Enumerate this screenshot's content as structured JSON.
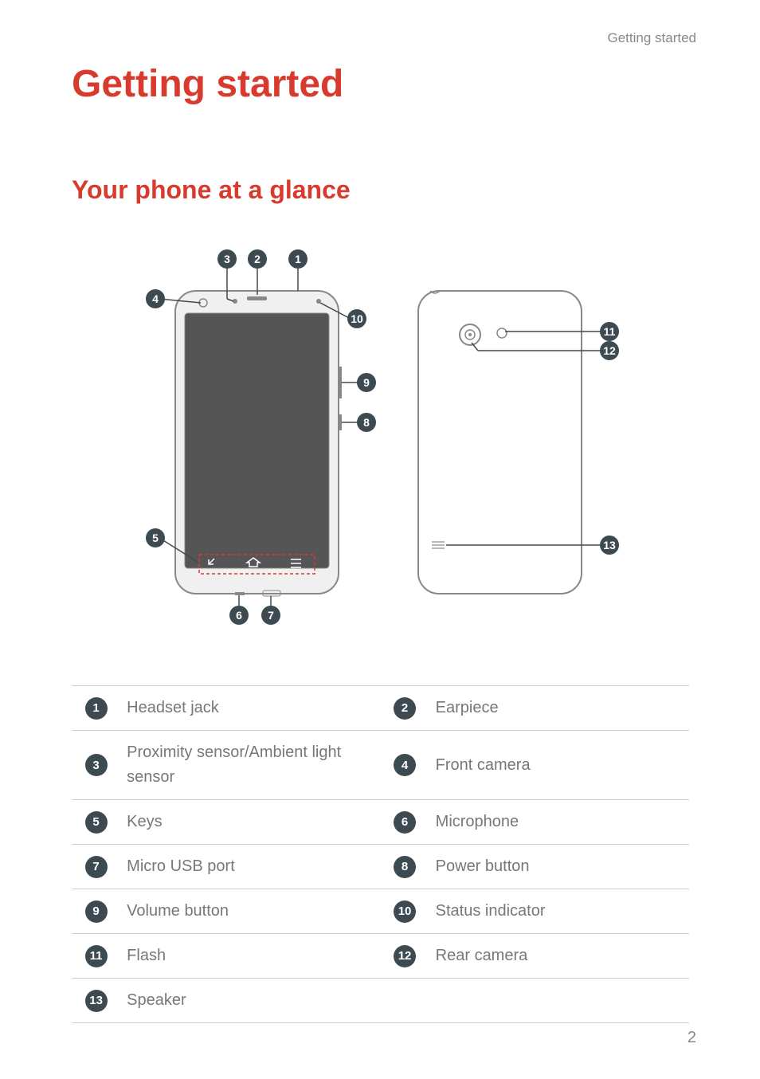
{
  "header_label": "Getting started",
  "title": "Getting started",
  "subtitle": "Your phone at a glance",
  "page_number": "2",
  "parts": [
    {
      "num": "1",
      "label": "Headset jack"
    },
    {
      "num": "2",
      "label": "Earpiece"
    },
    {
      "num": "3",
      "label": "Proximity sensor/Ambient light sensor"
    },
    {
      "num": "4",
      "label": "Front camera"
    },
    {
      "num": "5",
      "label": "Keys"
    },
    {
      "num": "6",
      "label": "Microphone"
    },
    {
      "num": "7",
      "label": "Micro USB port"
    },
    {
      "num": "8",
      "label": "Power button"
    },
    {
      "num": "9",
      "label": "Volume button"
    },
    {
      "num": "10",
      "label": "Status indicator"
    },
    {
      "num": "11",
      "label": "Flash"
    },
    {
      "num": "12",
      "label": "Rear camera"
    },
    {
      "num": "13",
      "label": "Speaker"
    }
  ],
  "diagram_callouts": {
    "c1": "1",
    "c2": "2",
    "c3": "3",
    "c4": "4",
    "c5": "5",
    "c6": "6",
    "c7": "7",
    "c8": "8",
    "c9": "9",
    "c10": "10",
    "c11": "11",
    "c12": "12",
    "c13": "13"
  }
}
